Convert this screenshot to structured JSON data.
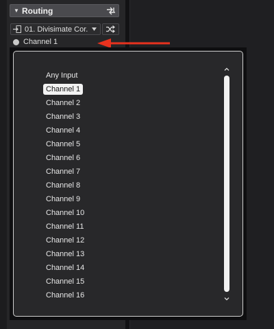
{
  "routing": {
    "title": "Routing",
    "input_device": "01. Divisimate Cor.",
    "channel": "Channel 1"
  },
  "popup": {
    "items": [
      "Any Input",
      "Channel 1",
      "Channel 2",
      "Channel 3",
      "Channel 4",
      "Channel 5",
      "Channel 6",
      "Channel 7",
      "Channel 8",
      "Channel 9",
      "Channel 10",
      "Channel 11",
      "Channel 12",
      "Channel 13",
      "Channel 14",
      "Channel 15",
      "Channel 16"
    ],
    "selected": "Channel 1"
  },
  "colors": {
    "annotation_arrow": "#e8321e",
    "popup_border": "#d2d2d2",
    "selection_bg": "#f2f2f2"
  },
  "icons": {
    "section_caret": "triangle-down",
    "routing": "routing-icon",
    "input": "input-port-icon",
    "dropdown": "triangle-down",
    "shuffle": "shuffle-icon",
    "channel": "channel-dot-icon",
    "scroll_up": "chevron-up-icon",
    "scroll_down": "chevron-down-icon"
  }
}
